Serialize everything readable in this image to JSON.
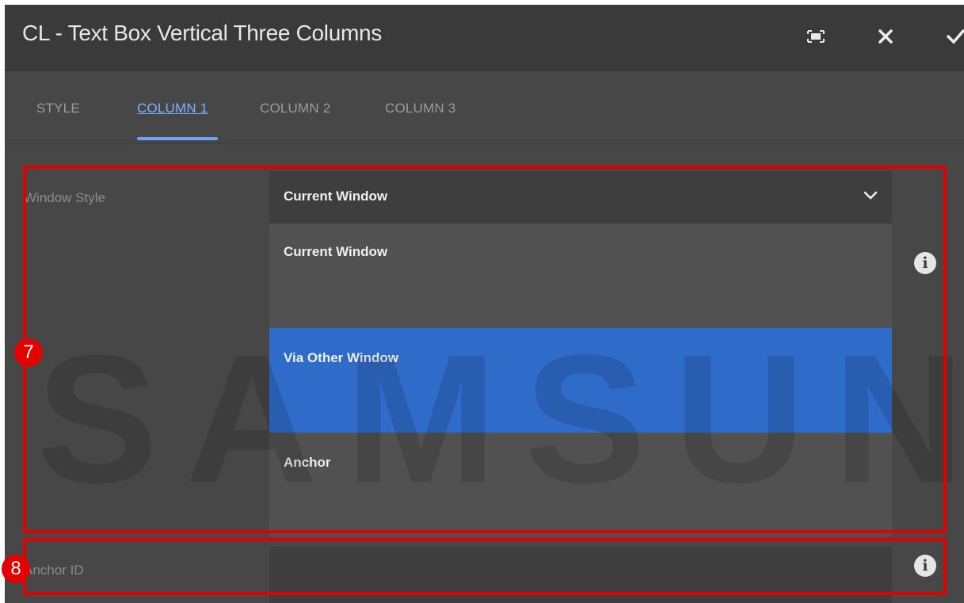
{
  "dialog": {
    "title": "CL - Text Box Vertical Three Columns",
    "icons": {
      "fullscreen": "fullscreen-icon",
      "close": "close-icon",
      "confirm": "check-icon"
    }
  },
  "tabs": [
    {
      "label": "STYLE",
      "active": false
    },
    {
      "label": "COLUMN 1",
      "active": true
    },
    {
      "label": "COLUMN 2",
      "active": false
    },
    {
      "label": "COLUMN 3",
      "active": false
    }
  ],
  "fields": {
    "window_style": {
      "label": "Window Style",
      "value": "Current Window",
      "options": [
        "Current Window",
        "Via Other Window",
        "Anchor"
      ],
      "highlighted": "Via Other Window"
    },
    "anchor_id": {
      "label": "Anchor ID",
      "value": ""
    }
  },
  "annotations": {
    "marker_7": "7",
    "marker_8": "8",
    "color": "#e50000"
  },
  "watermark": "SAMSUNG",
  "colors": {
    "accent": "#6fa3f5",
    "selected_bg": "#2f6bc9"
  }
}
